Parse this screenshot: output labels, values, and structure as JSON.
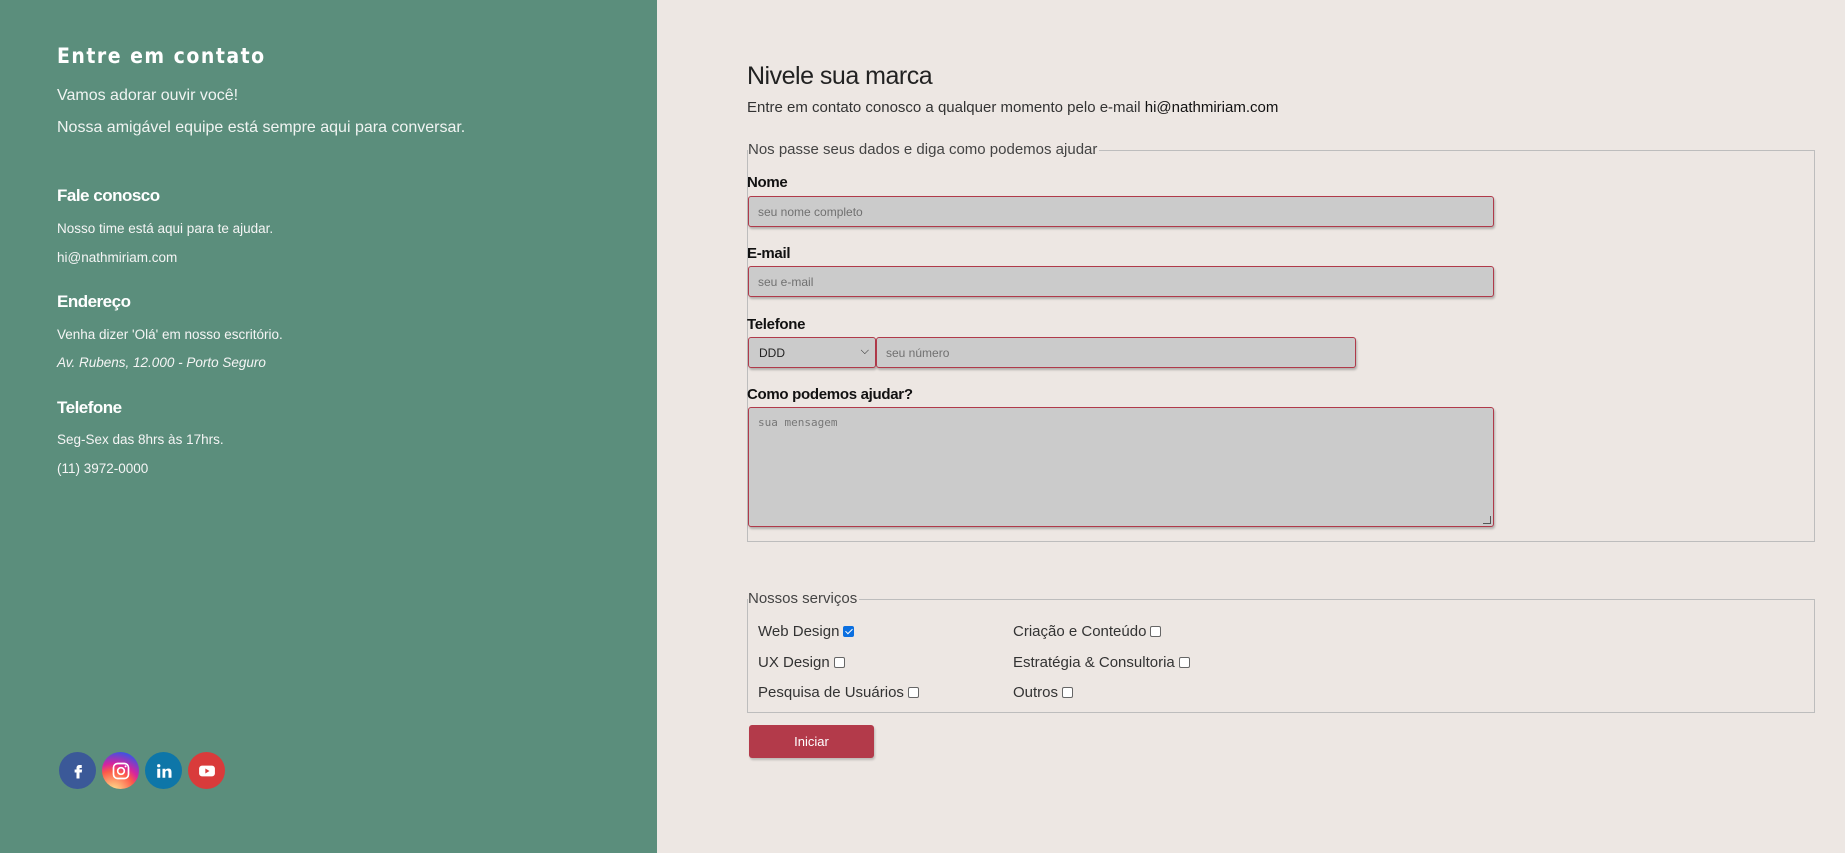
{
  "sidebar": {
    "title": "Entre em contato",
    "intro1": "Vamos adorar ouvir você!",
    "intro2": "Nossa amigável equipe está sempre aqui para conversar.",
    "contact": {
      "heading": "Fale conosco",
      "line1": "Nosso time está aqui para te ajudar.",
      "line2": "hi@nathmiriam.com"
    },
    "address": {
      "heading": "Endereço",
      "line1": "Venha dizer 'Olá' em nosso escritório.",
      "line2": "Av. Rubens, 12.000 - Porto Seguro"
    },
    "phone": {
      "heading": "Telefone",
      "line1": "Seg-Sex das 8hrs às 17hrs.",
      "line2": "(11) 3972-0000"
    },
    "social": [
      "facebook-icon",
      "instagram-icon",
      "linkedin-icon",
      "youtube-icon"
    ]
  },
  "main": {
    "title": "Nivele sua marca",
    "subtitle_prefix": "Entre em contato conosco a qualquer momento pelo e-mail ",
    "subtitle_email": "hi@nathmiriam.com",
    "form_legend": "Nos passe seus dados e diga como podemos ajudar",
    "name_label": "Nome",
    "name_placeholder": "seu nome completo",
    "email_label": "E-mail",
    "email_placeholder": "seu e-mail",
    "phone_label": "Telefone",
    "ddd_value": "DDD",
    "phone_placeholder": "seu número",
    "message_label": "Como podemos ajudar?",
    "message_placeholder": "sua mensagem",
    "services_legend": "Nossos serviços",
    "services": [
      {
        "label": "Web Design",
        "checked": true
      },
      {
        "label": "UX Design",
        "checked": false
      },
      {
        "label": "Pesquisa de Usuários",
        "checked": false
      },
      {
        "label": "Criação e Conteúdo",
        "checked": false
      },
      {
        "label": "Estratégia & Consultoria",
        "checked": false
      },
      {
        "label": "Outros",
        "checked": false
      }
    ],
    "submit_label": "Iniciar"
  },
  "colors": {
    "panel": "#5b8e7c",
    "background": "#ede7e3",
    "accent": "#b33a4a",
    "checkbox": "#0b6fe0"
  }
}
